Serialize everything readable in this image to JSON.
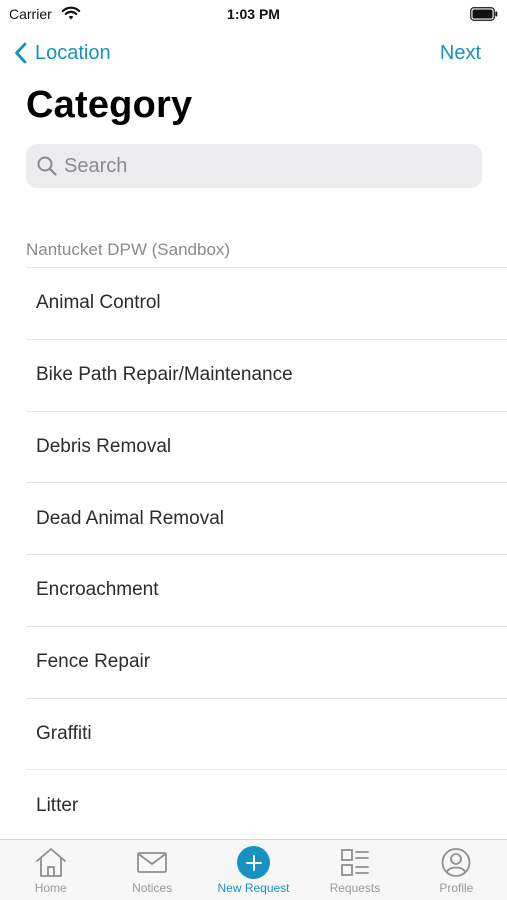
{
  "status_bar": {
    "carrier": "Carrier",
    "time": "1:03 PM"
  },
  "nav": {
    "back_label": "Location",
    "next_label": "Next"
  },
  "page": {
    "title": "Category"
  },
  "search": {
    "placeholder": "Search",
    "value": ""
  },
  "section": {
    "header": "Nantucket DPW (Sandbox)"
  },
  "categories": [
    {
      "label": "Animal Control"
    },
    {
      "label": "Bike Path Repair/Maintenance"
    },
    {
      "label": "Debris Removal"
    },
    {
      "label": "Dead Animal Removal"
    },
    {
      "label": "Encroachment"
    },
    {
      "label": "Fence Repair"
    },
    {
      "label": "Graffiti"
    },
    {
      "label": "Litter"
    }
  ],
  "tab_bar": {
    "tabs": [
      {
        "label": "Home",
        "icon": "home-icon"
      },
      {
        "label": "Notices",
        "icon": "mail-icon"
      },
      {
        "label": "New Request",
        "icon": "plus-circle-icon",
        "active": true
      },
      {
        "label": "Requests",
        "icon": "list-icon"
      },
      {
        "label": "Profile",
        "icon": "user-icon"
      }
    ]
  },
  "colors": {
    "accent": "#1693c3",
    "inactive": "#9a9a9e",
    "search_bg": "#ececee"
  }
}
